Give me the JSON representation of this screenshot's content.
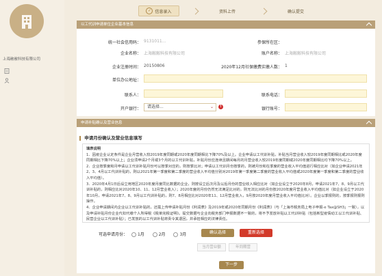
{
  "sidebar": {
    "company_name": "上海敝敝科技有限公司",
    "icon_1": "document-icon",
    "icon_2": "user-icon"
  },
  "steps": [
    {
      "label": "信息录入",
      "active": true
    },
    {
      "label": "资料上传",
      "active": false
    },
    {
      "label": "确认提交",
      "active": false
    }
  ],
  "company_section": {
    "title": "以工代训申请单位企业基本信息",
    "labels": {
      "credit_code": "统一社会信用码：",
      "insured_area": "参保所在区：",
      "company_name": "企业名称：",
      "account_name": "账户名称：",
      "reg_time": "企业注册时间：",
      "insured_count": "2020年12月社保缴费实缴人数：",
      "office_address": "单位办公地址：",
      "contact": "联系人：",
      "phone": "联系电话：",
      "bank": "开户银行：",
      "bank_account": "银行账号："
    },
    "values": {
      "credit_code": "9131011...",
      "company_name": "上海敝敝科技有限公司",
      "account_name": "上海敝敝科技有限公司",
      "reg_time": "20150806",
      "insured_count": "1"
    },
    "bank_select": {
      "placeholder": "请选择..."
    }
  },
  "apply_section": {
    "title": "申请补贴确认及营业信息",
    "sub_title": "申请月份确认及营业信息填写",
    "notice_title": "填表说明",
    "notice_lines": [
      "1．因疫企业认定条件是企业月营收入较2019年度同期或2020年度同期相比下降70%及以上。企业申请以工代训补贴，补贴当月营业收入较2019年度同期相比或2020年度同期相比下降70%以上；企业须申请2个月或3个月的以工代训补贴，补贴月份应连续且期间每月的月营业收入较2019年度同期或2020年度同期相比均下降70%以上。",
      "2．企业按季度和月申请以工代训补贴月份可以按季对应的，则按季比对；申请以工代训月份按季的，则被月份和在季度的营业收入平均值进行相应比对（如企业申请2021年2、3、4月以工代训补贴的，则以2021年第一季度和第二季度的营业收入平均值分别对2019年第一季度第二季度的营业收入平均值或2020年度第一季度和第二季度的营业收入平均值）。",
      "3．2020年4月1日后设立用地区2020年度月度同比数据的企业，则按设立后次月及以后月份的营业收入相应比对（如企业设立于2020年8月，申请2021年7、8、9月以工代训补贴的，则相应比对2020年10、11、12月营业收入）；2020年度的月份仍然无法满足比对的，则无法比对的月份按2020年度月营业收入平均值比对（如企业设立于2020年10月，申请2021年7、8、9月以工代训补贴的，则7、8月相应比对2020年11、12月营业收入，9月按2020年度月营业收入平均值比对）。企业以季报则的，按季报则报则操作。",
      "4．企业申请期间内企业以工代训补贴的，还需上传申请补贴月份《利润表》及2019年或2020年同期月份《利润表》（与「上海市税务局上电子申报-e Tax@SH3」一致），以及申请补贴月份企业代扣代缴个人所得税《税单完税证明》。提交数据与企业向税务部门申报数据不一致的，将不予发放补贴以工代训补贴（包括新型疫情动工以工代训补贴、民营企业以工代训补贴）；已发放的以工代训补贴将责令其退回，并承担相应的法律责任。"
    ],
    "month_label": "可选申请月份：",
    "months": [
      "1月",
      "2月",
      "3月"
    ],
    "confirm_button": "确认选择",
    "reselect_button": "重新选择",
    "gray_btn_1": "当月营业额",
    "gray_btn_2": "年同期营",
    "next_button": "下一步"
  },
  "colors": {
    "accent": "#b9a078",
    "primary_button": "#a7874e",
    "danger_button": "#d23a2a",
    "background": "#f3ecdf"
  }
}
